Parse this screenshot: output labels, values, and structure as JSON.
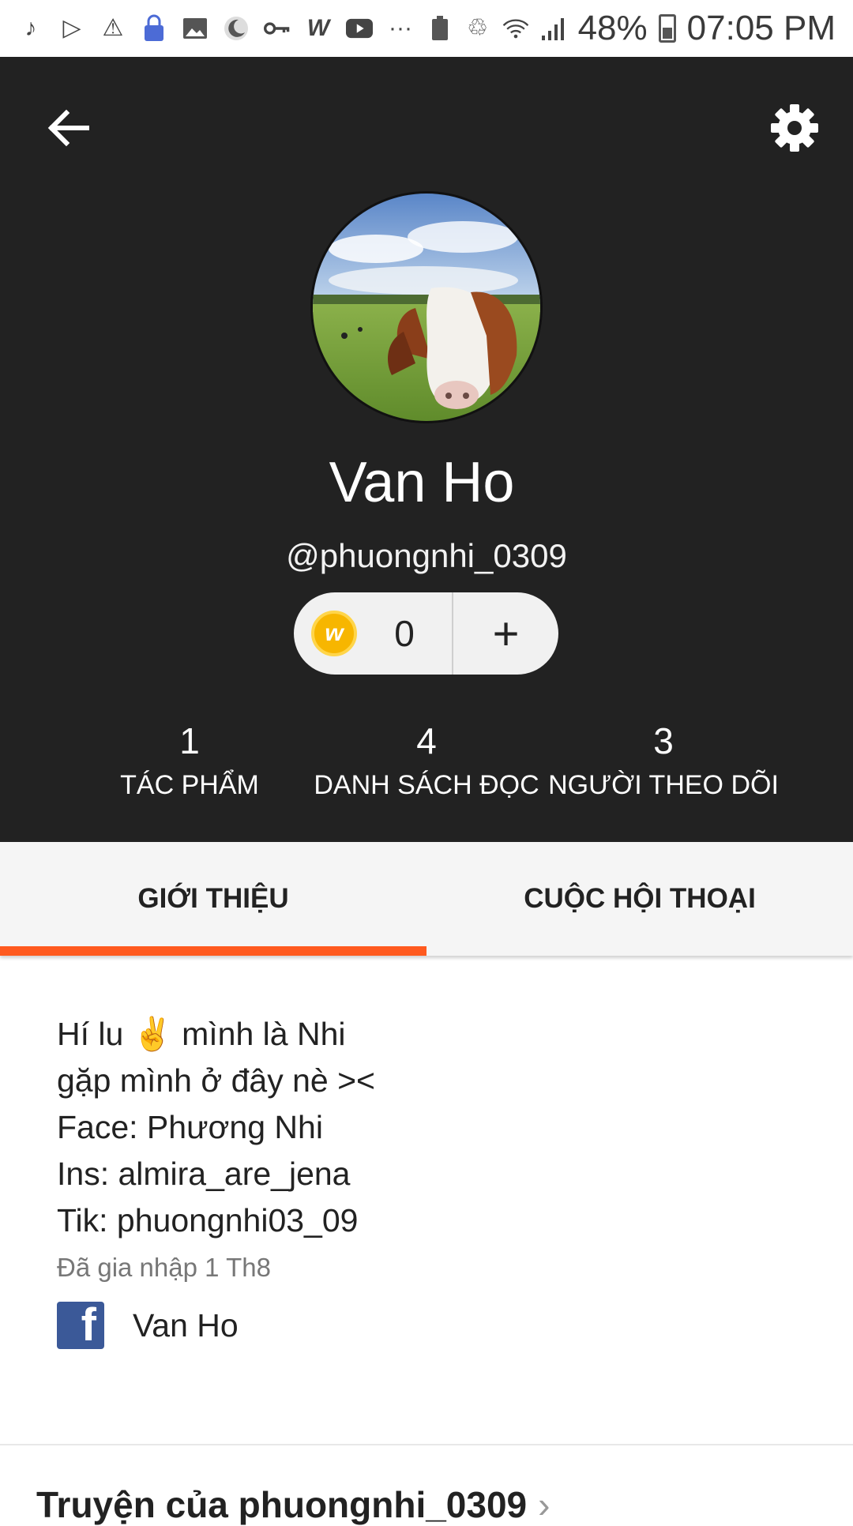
{
  "status_bar": {
    "battery_percent": "48%",
    "time": "07:05 PM",
    "icons": [
      "tiktok-icon",
      "play-store-icon",
      "warning-icon",
      "lock-icon",
      "image-icon",
      "moon-icon",
      "key-icon",
      "wattpad-icon",
      "youtube-icon",
      "more-dots-icon",
      "battery-saver-icon",
      "recycle-icon",
      "wifi-icon",
      "signal-icon",
      "battery-icon"
    ]
  },
  "profile": {
    "display_name": "Van Ho",
    "username": "@phuongnhi_0309",
    "coins": "0",
    "add_coins_label": "+",
    "coin_symbol": "w",
    "stats": [
      {
        "value": "1",
        "label": "TÁC PHẨM"
      },
      {
        "value": "4",
        "label": "DANH SÁCH ĐỌC"
      },
      {
        "value": "3",
        "label": "NGƯỜI THEO DÕI"
      }
    ]
  },
  "tabs": [
    {
      "label": "GIỚI THIỆU",
      "active": true
    },
    {
      "label": "CUỘC HỘI THOẠI",
      "active": false
    }
  ],
  "about": {
    "lines": [
      "Hí lu ✌️ mình là Nhi",
      "gặp mình ở đây nè ><",
      "Face: Phương Nhi",
      "Ins: almira_are_jena",
      "Tik: phuongnhi03_09"
    ],
    "joined": "Đã gia nhập 1 Th8",
    "facebook_letter": "f",
    "facebook_name": "Van Ho"
  },
  "stories_section": {
    "title": "Truyện của phuongnhi_0309",
    "chevron": "›"
  },
  "colors": {
    "header_bg": "#222222",
    "accent": "#ff5a1f",
    "facebook": "#3b5998",
    "coin": "#f7b600"
  }
}
